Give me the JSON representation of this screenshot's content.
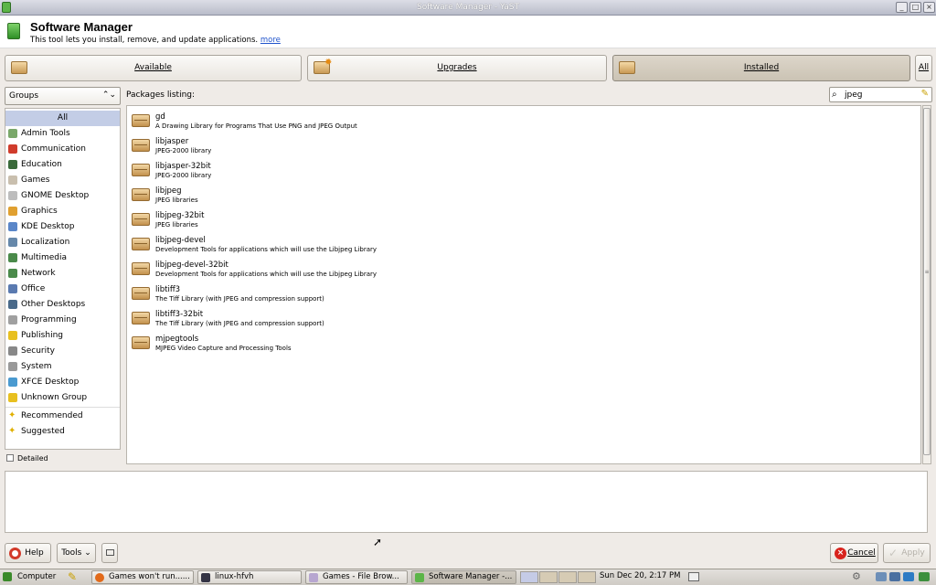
{
  "window": {
    "title": "Software Manager - YaST"
  },
  "header": {
    "title": "Software Manager",
    "subtitle": "This tool lets you install, remove, and update applications.",
    "more_link": "more"
  },
  "views": {
    "available": "Available",
    "upgrades": "Upgrades",
    "installed": "Installed",
    "all": "All",
    "active": "installed"
  },
  "groups": {
    "selector_label": "Groups",
    "items": [
      "All",
      "Admin Tools",
      "Communication",
      "Education",
      "Games",
      "GNOME Desktop",
      "Graphics",
      "KDE Desktop",
      "Localization",
      "Multimedia",
      "Network",
      "Office",
      "Other Desktops",
      "Programming",
      "Publishing",
      "Security",
      "System",
      "XFCE Desktop",
      "Unknown Group"
    ],
    "extra_items": [
      "Recommended",
      "Suggested"
    ],
    "selected": "All",
    "icon_colors": [
      "#c3cde6",
      "#7aa86a",
      "#d03c2c",
      "#3a6a3a",
      "#c9bfae",
      "#bdbdbd",
      "#e0a030",
      "#5a86c8",
      "#6688aa",
      "#4a8a4a",
      "#4a8a4a",
      "#5a7ab0",
      "#4a6a8a",
      "#a0a0a0",
      "#e8c020",
      "#888888",
      "#999999",
      "#4a9ad0",
      "#e8c020"
    ]
  },
  "detailed_label": "Detailed",
  "packages": {
    "label": "Packages listing:",
    "search_value": "jpeg",
    "items": [
      {
        "name": "gd",
        "desc": "A Drawing Library for Programs That Use PNG and JPEG Output"
      },
      {
        "name": "libjasper",
        "desc": "JPEG-2000 library"
      },
      {
        "name": "libjasper-32bit",
        "desc": "JPEG-2000 library"
      },
      {
        "name": "libjpeg",
        "desc": "JPEG libraries"
      },
      {
        "name": "libjpeg-32bit",
        "desc": "JPEG libraries"
      },
      {
        "name": "libjpeg-devel",
        "desc": "Development Tools for applications which will use the Libjpeg Library"
      },
      {
        "name": "libjpeg-devel-32bit",
        "desc": "Development Tools for applications which will use the Libjpeg Library"
      },
      {
        "name": "libtiff3",
        "desc": "The Tiff Library (with JPEG and compression support)"
      },
      {
        "name": "libtiff3-32bit",
        "desc": "The Tiff Library (with JPEG and compression support)"
      },
      {
        "name": "mjpegtools",
        "desc": "MJPEG Video Capture and Processing Tools"
      }
    ]
  },
  "buttons": {
    "help": "Help",
    "tools": "Tools",
    "cancel": "Cancel",
    "apply": "Apply"
  },
  "taskbar": {
    "computer": "Computer",
    "windows": [
      "Games won't run......",
      "linux-hfvh",
      "Games - File Brow...",
      "Software Manager -..."
    ],
    "clock": "Sun Dec 20,  2:17 PM"
  }
}
